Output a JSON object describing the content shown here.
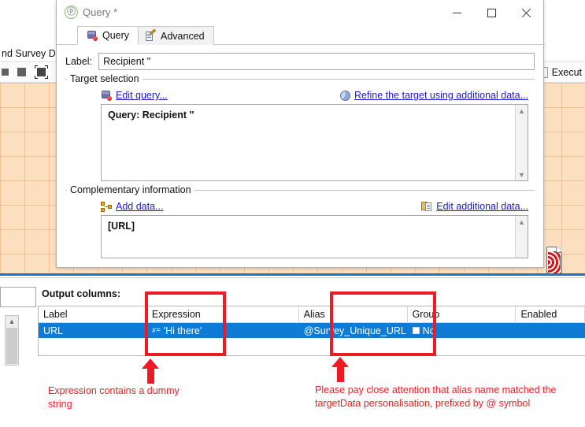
{
  "background_app": {
    "menubar_text": "nd Survey Dec",
    "toolbar": {
      "execute_label": "Execut",
      "icons": [
        "square-small-icon",
        "square-medium-icon",
        "select-frame-icon"
      ]
    },
    "canvas_icon": "red-delivery-icon"
  },
  "dialog": {
    "title": "Query *",
    "title_icon": "query-app-icon",
    "window_buttons": {
      "minimize": "minimize-icon",
      "maximize": "maximize-icon",
      "close": "close-icon"
    },
    "tabs": [
      {
        "label": "Query",
        "icon": "database-icon",
        "active": true
      },
      {
        "label": "Advanced",
        "icon": "document-pencil-icon",
        "active": false
      }
    ],
    "label_field": {
      "label": "Label:",
      "value": "Recipient ''",
      "placeholder": ""
    },
    "target_selection": {
      "group_title": "Target selection",
      "edit_query_link": "Edit query...",
      "edit_query_icon": "database-icon",
      "refine_link": "Refine the target using additional data...",
      "refine_icon": "pie-chart-icon",
      "query_text": "Query: Recipient ''"
    },
    "complementary_information": {
      "group_title": "Complementary information",
      "add_data_link": "Add data...",
      "add_data_icon": "nodes-icon",
      "edit_additional_link": "Edit additional data...",
      "edit_additional_icon": "copy-document-icon",
      "data_text": "[URL]"
    }
  },
  "output_columns": {
    "title": "Output columns:",
    "headers": [
      "Label",
      "Expression",
      "Alias",
      "Group",
      "Enabled"
    ],
    "rows": [
      {
        "label": "URL",
        "expression": "'Hi there'",
        "expression_icon": "fx-icon",
        "expression_prefix": "x=",
        "alias": "@Survey_Unique_URL",
        "group": "No",
        "group_checkbox": "unchecked-checkbox-icon",
        "enabled": "",
        "selected": true
      }
    ]
  },
  "annotations": {
    "highlight_color": "#ed1c24",
    "boxes": [
      {
        "name": "expression-highlight"
      },
      {
        "name": "alias-highlight"
      }
    ],
    "notes": [
      "Expression contains a dummy string",
      "Please pay close attention that alias name matched the targetData personalisation, prefixed by @ symbol"
    ]
  }
}
